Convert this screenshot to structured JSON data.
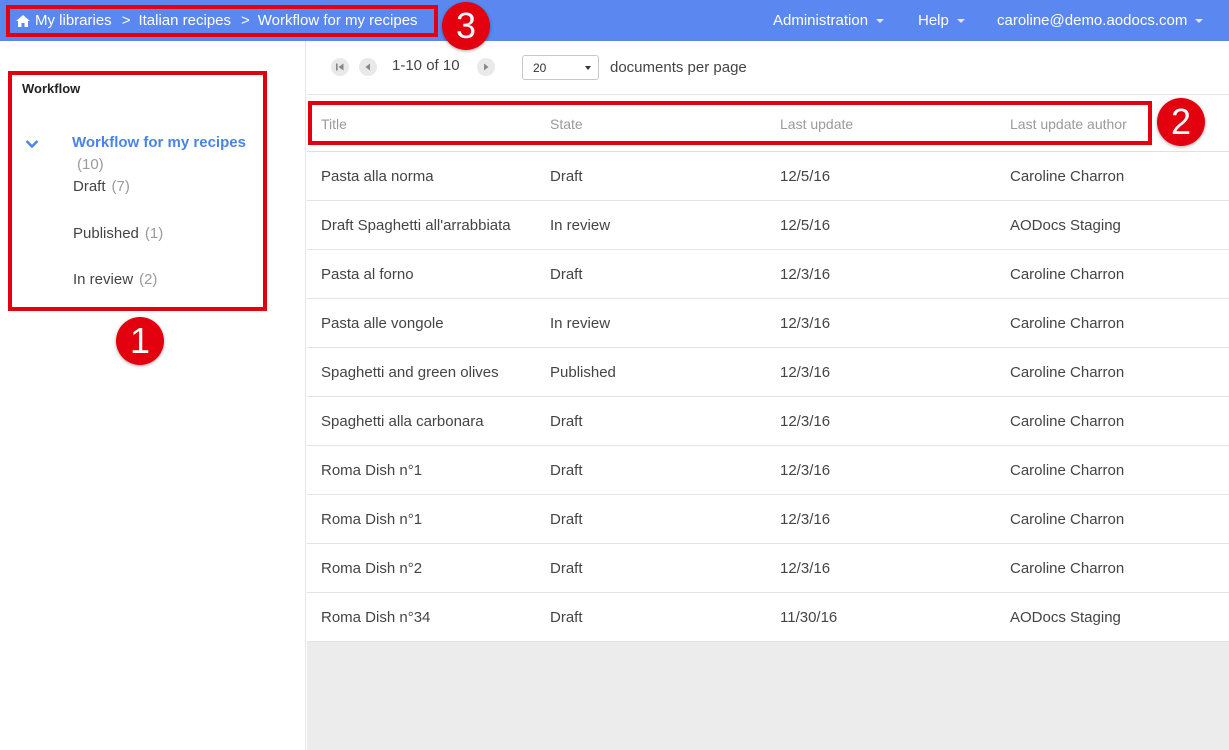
{
  "topbar": {
    "breadcrumbs": [
      "My libraries",
      "Italian recipes",
      "Workflow for my recipes"
    ],
    "separator": ">",
    "menus": [
      "Administration",
      "Help",
      "caroline@demo.aodocs.com"
    ],
    "icons": [
      "home-icon"
    ],
    "bar_color": "#5b87f0"
  },
  "sidebar": {
    "title": "Workflow",
    "workflow": {
      "name": "Workflow for my recipes",
      "count": "(10)"
    },
    "states": [
      {
        "label": "Draft",
        "count": "(7)"
      },
      {
        "label": "Published",
        "count": "(1)"
      },
      {
        "label": "In review",
        "count": "(2)"
      }
    ],
    "icons": [
      "chevron-down-icon"
    ]
  },
  "pager": {
    "range": "1-10 of 10",
    "per_page_value": "20",
    "per_page_label": "documents per page",
    "icons": [
      "first-page-icon",
      "previous-page-icon",
      "next-page-icon"
    ]
  },
  "table": {
    "columns": [
      "Title",
      "State",
      "Last update",
      "Last update author"
    ],
    "rows": [
      [
        "Pasta alla norma",
        "Draft",
        "12/5/16",
        "Caroline Charron"
      ],
      [
        "Draft Spaghetti all'arrabbiata",
        "In review",
        "12/5/16",
        "AODocs Staging"
      ],
      [
        "Pasta al forno",
        "Draft",
        "12/3/16",
        "Caroline Charron"
      ],
      [
        "Pasta alle vongole",
        "In review",
        "12/3/16",
        "Caroline Charron"
      ],
      [
        "Spaghetti and green olives",
        "Published",
        "12/3/16",
        "Caroline Charron"
      ],
      [
        "Spaghetti alla carbonara",
        "Draft",
        "12/3/16",
        "Caroline Charron"
      ],
      [
        "Roma Dish n°1",
        "Draft",
        "12/3/16",
        "Caroline Charron"
      ],
      [
        "Roma Dish n°1",
        "Draft",
        "12/3/16",
        "Caroline Charron"
      ],
      [
        "Roma Dish n°2",
        "Draft",
        "12/3/16",
        "Caroline Charron"
      ],
      [
        "Roma Dish n°34",
        "Draft",
        "11/30/16",
        "AODocs Staging"
      ]
    ]
  },
  "annotations": {
    "markers": [
      "1",
      "2",
      "3"
    ],
    "color": "#e3000f"
  }
}
